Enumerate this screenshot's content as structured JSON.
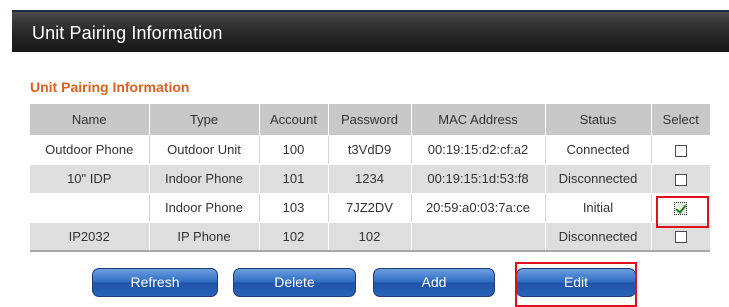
{
  "window": {
    "title": "Unit Pairing Information"
  },
  "section": {
    "heading": "Unit Pairing Information"
  },
  "table": {
    "columns": [
      "Name",
      "Type",
      "Account",
      "Password",
      "MAC Address",
      "Status",
      "Select"
    ],
    "rows": [
      {
        "name": "Outdoor Phone",
        "type": "Outdoor Unit",
        "account": "100",
        "password": "t3VdD9",
        "mac": "00:19:15:d2:cf:a2",
        "status": "Connected",
        "selected": false
      },
      {
        "name": "10\" IDP",
        "type": "Indoor Phone",
        "account": "101",
        "password": "1234",
        "mac": "00:19:15:1d:53:f8",
        "status": "Disconnected",
        "selected": false
      },
      {
        "name": "",
        "type": "Indoor Phone",
        "account": "103",
        "password": "7JZ2DV",
        "mac": "20:59:a0:03:7a:ce",
        "status": "Initial",
        "selected": true
      },
      {
        "name": "IP2032",
        "type": "IP Phone",
        "account": "102",
        "password": "102",
        "mac": "",
        "status": "Disconnected",
        "selected": false
      }
    ]
  },
  "buttons": {
    "refresh": "Refresh",
    "delete": "Delete",
    "add": "Add",
    "edit": "Edit"
  },
  "colors": {
    "heading_accent": "#e0601a",
    "button_blue": "#2f6cc2",
    "highlight_red": "#e0101a"
  }
}
